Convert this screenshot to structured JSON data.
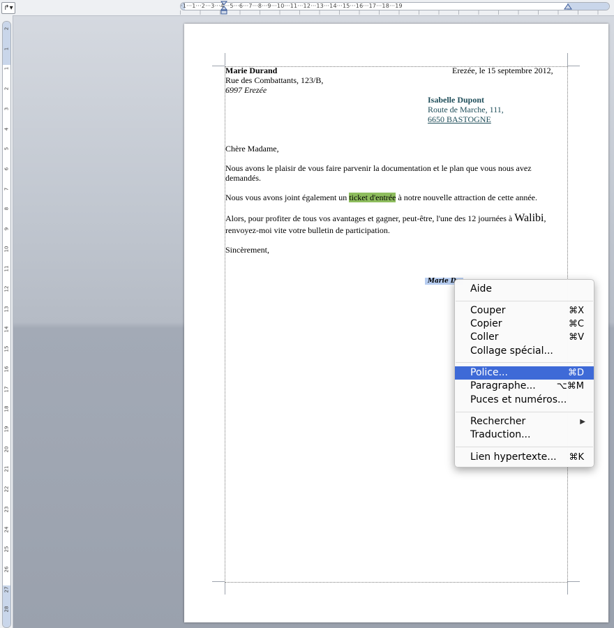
{
  "ruler": {
    "tab_selector": "↱▾",
    "h_numbers": "·1···1···2···3···4···5···6···7···8···9···10···11···12···13···14···15···16···17···18···19",
    "v_numbers": [
      "2",
      "1",
      "1",
      "2",
      "3",
      "4",
      "5",
      "6",
      "7",
      "8",
      "9",
      "10",
      "11",
      "12",
      "13",
      "14",
      "15",
      "16",
      "17",
      "18",
      "19",
      "20",
      "21",
      "22",
      "23",
      "24",
      "25",
      "26",
      "27",
      "28"
    ]
  },
  "letter": {
    "sender_name": "Marie Durand",
    "sender_street": "Rue des Combattants, 123/B,",
    "sender_city": "6997 Erezée",
    "date_line": "Erezée, le 15 septembre 2012,",
    "recipient_name": "Isabelle Dupont",
    "recipient_street": "Route de Marche, 111,",
    "recipient_city": "6650 BASTOGNE",
    "salutation": "Chère Madame,",
    "para1_line1": "Nous avons le plaisir de vous faire parvenir la documentation et le plan que vous nous avez",
    "para1_line2": "demandés.",
    "para2_before": "Nous vous avons joint également un",
    "para2_highlight": "ticket d'entrée",
    "para2_after": "à notre nouvelle attraction de cette année.",
    "para3_line1_before": "Alors, pour profiter de tous vos avantages et gagner, peut-être, l'une des 12 journées à",
    "para3_brand": "Walibi",
    "para3_line1_after": ",",
    "para3_line2": "renvoyez-moi vite votre bulletin de participation.",
    "closing": "Sincèrement,",
    "signature": "Marie Du"
  },
  "context_menu": {
    "items": [
      {
        "label": "Aide",
        "shortcut": ""
      },
      {
        "label": "Couper",
        "shortcut": "⌘X"
      },
      {
        "label": "Copier",
        "shortcut": "⌘C"
      },
      {
        "label": "Coller",
        "shortcut": "⌘V"
      },
      {
        "label": "Collage spécial...",
        "shortcut": ""
      },
      {
        "label": "Police...",
        "shortcut": "⌘D"
      },
      {
        "label": "Paragraphe...",
        "shortcut": "⌥⌘M"
      },
      {
        "label": "Puces et numéros...",
        "shortcut": ""
      },
      {
        "label": "Rechercher",
        "shortcut": "▶"
      },
      {
        "label": "Traduction...",
        "shortcut": ""
      },
      {
        "label": "Lien hypertexte...",
        "shortcut": "⌘K"
      }
    ],
    "selected_index": 5
  },
  "colors": {
    "highlight": "#8ebd5e",
    "menu_selection": "#3e6ad7",
    "recipient_text": "#1f4e5a"
  }
}
